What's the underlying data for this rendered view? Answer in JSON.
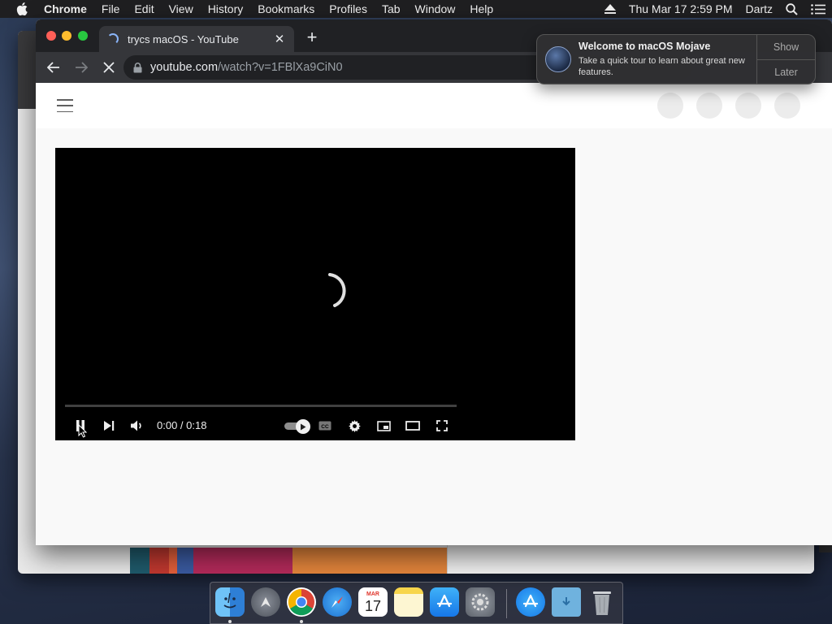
{
  "menubar": {
    "app_name": "Chrome",
    "items": [
      "File",
      "Edit",
      "View",
      "History",
      "Bookmarks",
      "Profiles",
      "Tab",
      "Window",
      "Help"
    ],
    "datetime": "Thu Mar 17  2:59 PM",
    "user": "Dartz",
    "icons": [
      "apple-icon",
      "eject-icon",
      "spotlight-search-icon",
      "control-menu-icon"
    ]
  },
  "browser": {
    "tab_title": "trycs macOS - YouTube",
    "url_host": "youtube.com",
    "url_path": "/watch?v=1FBlXa9CiN0",
    "loading": true
  },
  "player": {
    "time_display": "0:00 / 0:18",
    "playing": true,
    "progress_fraction": 0.0,
    "autoplay_on": true
  },
  "notification": {
    "title": "Welcome to macOS Mojave",
    "body": "Take a quick tour to learn about great new features.",
    "show_label": "Show",
    "later_label": "Later"
  },
  "dock": {
    "calendar_month": "MAR",
    "calendar_day": "17",
    "apps": [
      "Finder",
      "Launchpad",
      "Google Chrome",
      "Safari",
      "Calendar",
      "Notes",
      "App Store",
      "System Preferences",
      "App Store",
      "Downloads",
      "Trash"
    ]
  },
  "colors": {
    "menubar_bg": "#1f1f21",
    "chrome_tabbar": "#202124",
    "chrome_toolbar": "#35363a",
    "player_bg": "#000000",
    "close": "#ff5f57",
    "minimize": "#febc2e",
    "maximize": "#28c840"
  }
}
